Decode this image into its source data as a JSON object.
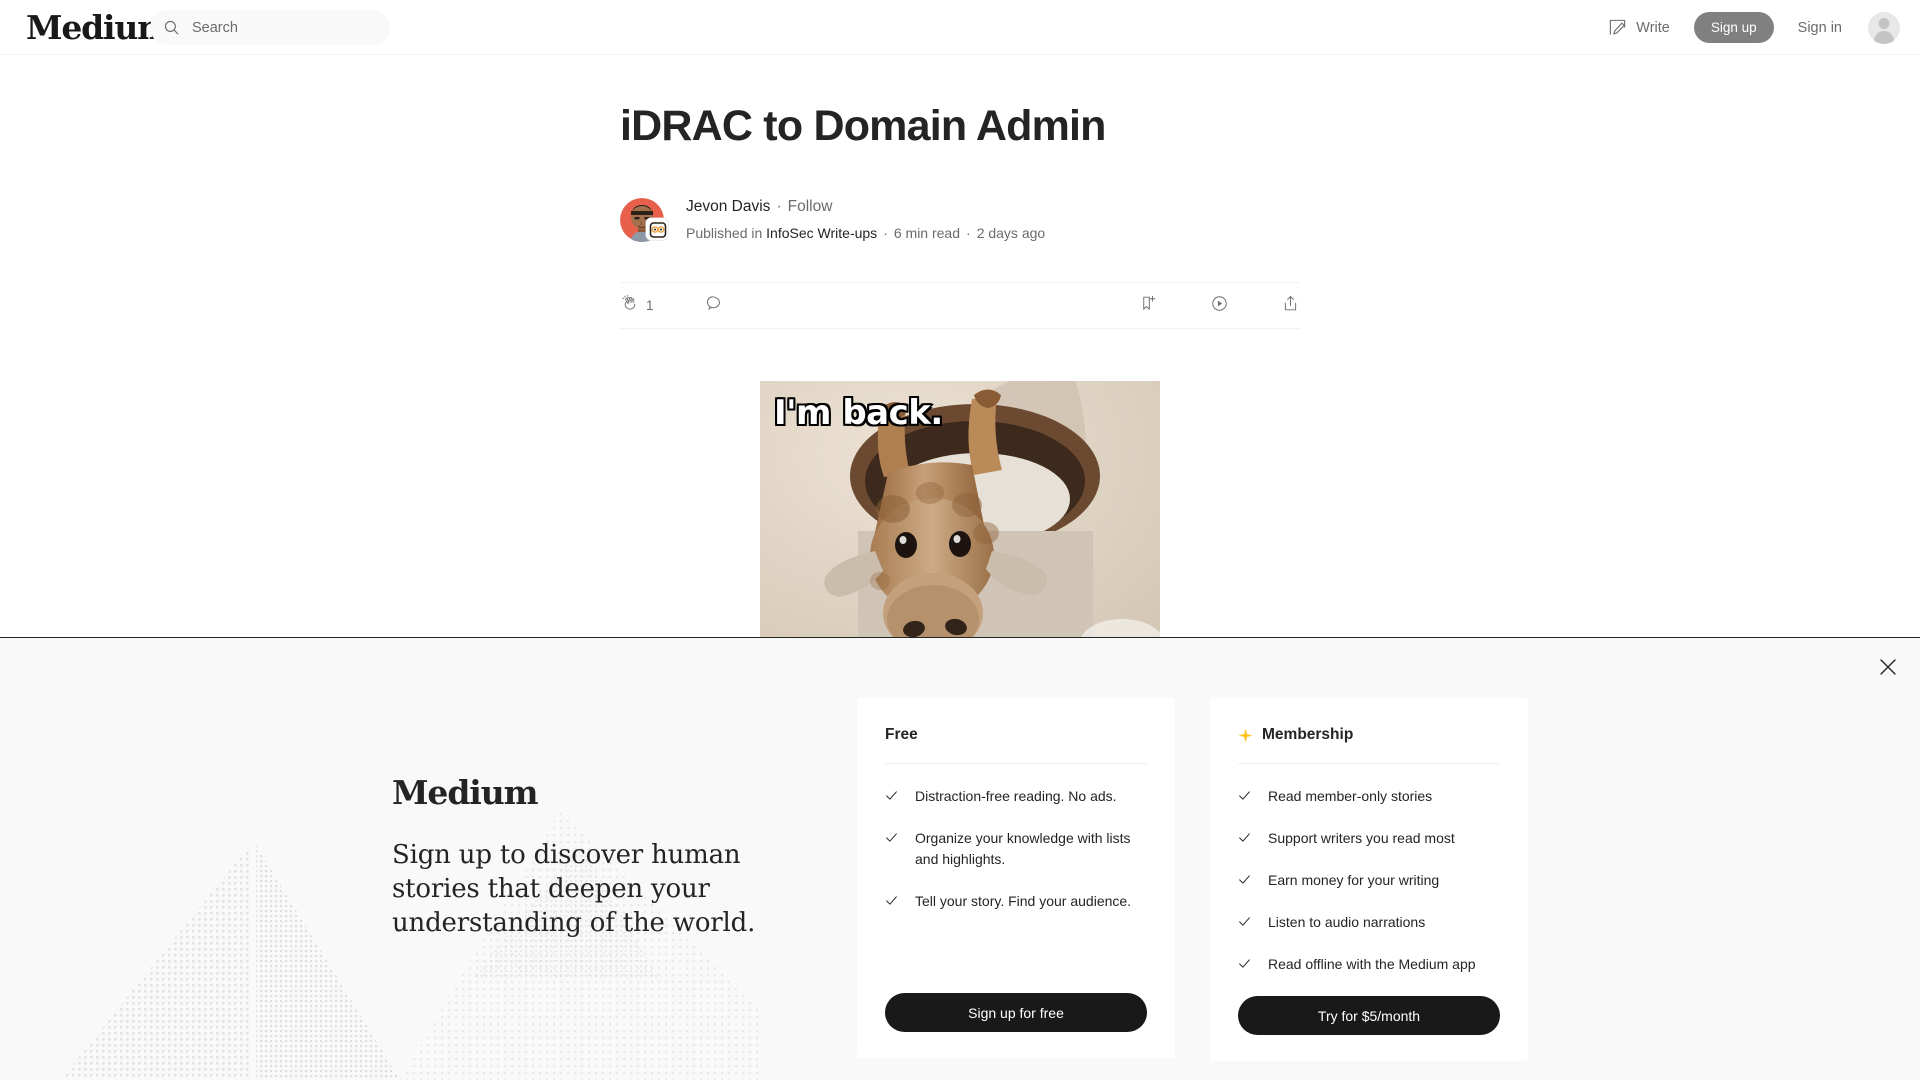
{
  "header": {
    "logo": "Medium",
    "search": {
      "placeholder": "Search",
      "value": ""
    },
    "write_label": "Write",
    "signup_label": "Sign up",
    "signin_label": "Sign in"
  },
  "article": {
    "title": "iDRAC to Domain Admin",
    "author": "Jevon Davis",
    "follow_label": "Follow",
    "published_prefix": "Published in",
    "publication": "InfoSec Write-ups",
    "read_time": "6 min read",
    "published_ago": "2 days ago",
    "separator": "·",
    "clap_count": "1",
    "hero_caption": "I'm back."
  },
  "banner": {
    "logo": "Medium",
    "headline": "Sign up to discover human stories that deepen your understanding of the world.",
    "free": {
      "title": "Free",
      "features": [
        "Distraction-free reading. No ads.",
        "Organize your knowledge with lists and highlights.",
        "Tell your story. Find your audience."
      ],
      "cta": "Sign up for free"
    },
    "membership": {
      "title": "Membership",
      "features": [
        "Read member-only stories",
        "Support writers you read most",
        "Earn money for your writing",
        "Listen to audio narrations",
        "Read offline with the Medium app"
      ],
      "cta": "Try for $5/month"
    }
  },
  "colors": {
    "text_primary": "#242424",
    "text_secondary": "#6b6b6b",
    "cta_dark": "#191919",
    "signup_gray": "#808080",
    "star_gold": "#FFC017",
    "banner_bg": "#f9f9f9"
  }
}
